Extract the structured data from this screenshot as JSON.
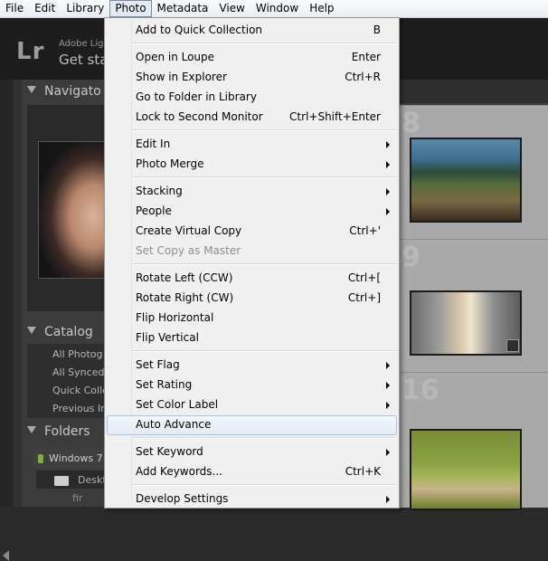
{
  "menubar": {
    "items": [
      "File",
      "Edit",
      "Library",
      "Photo",
      "Metadata",
      "View",
      "Window",
      "Help"
    ],
    "active": "Photo"
  },
  "app": {
    "logo": "Lr",
    "adobe_text": "Adobe Ligh",
    "get_started": "Get sta"
  },
  "left_panel": {
    "navigator": "Navigato",
    "catalog": "Catalog",
    "catalog_items": [
      "All Photog",
      "All Synced",
      "Quick Colle",
      "Previous In"
    ],
    "folders": "Folders",
    "folder_volume": "Windows 7",
    "folder_sub": "Deskt",
    "folder_sub2": "fir"
  },
  "grid": {
    "numbers": [
      "8",
      "9",
      "16"
    ]
  },
  "photo_menu": {
    "items": [
      {
        "label": "Add to Quick Collection",
        "shortcut": "B"
      },
      {
        "label": "Open in Loupe",
        "shortcut": "Enter"
      },
      {
        "label": "Show in Explorer",
        "shortcut": "Ctrl+R"
      },
      {
        "label": "Go to Folder in Library",
        "shortcut": ""
      },
      {
        "label": "Lock to Second Monitor",
        "shortcut": "Ctrl+Shift+Enter"
      },
      {
        "label": "Edit In",
        "shortcut": ""
      },
      {
        "label": "Photo Merge",
        "shortcut": ""
      },
      {
        "label": "Stacking",
        "shortcut": ""
      },
      {
        "label": "People",
        "shortcut": ""
      },
      {
        "label": "Create Virtual Copy",
        "shortcut": "Ctrl+'"
      },
      {
        "label": "Set Copy as Master",
        "shortcut": ""
      },
      {
        "label": "Rotate Left (CCW)",
        "shortcut": "Ctrl+["
      },
      {
        "label": "Rotate Right (CW)",
        "shortcut": "Ctrl+]"
      },
      {
        "label": "Flip Horizontal",
        "shortcut": ""
      },
      {
        "label": "Flip Vertical",
        "shortcut": ""
      },
      {
        "label": "Set Flag",
        "shortcut": ""
      },
      {
        "label": "Set Rating",
        "shortcut": ""
      },
      {
        "label": "Set Color Label",
        "shortcut": ""
      },
      {
        "label": "Auto Advance",
        "shortcut": ""
      },
      {
        "label": "Set Keyword",
        "shortcut": ""
      },
      {
        "label": "Add Keywords...",
        "shortcut": "Ctrl+K"
      },
      {
        "label": "Develop Settings",
        "shortcut": ""
      }
    ]
  }
}
